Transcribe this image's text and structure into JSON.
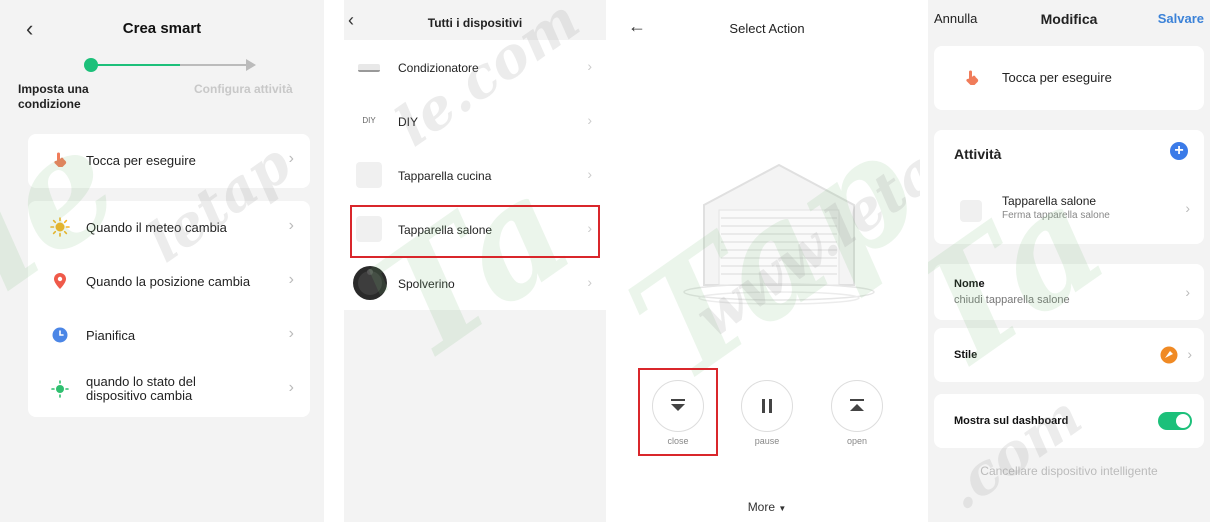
{
  "crea_smart": {
    "title": "Crea smart",
    "step1": "Imposta una condizione",
    "step2": "Configura attività",
    "tap_run": "Tocca per eseguire",
    "conditions": [
      {
        "label": "Quando il meteo cambia",
        "icon": "sun-icon"
      },
      {
        "label": "Quando la posizione cambia",
        "icon": "location-pin-icon"
      },
      {
        "label": "Pianifica",
        "icon": "clock-icon"
      },
      {
        "label": "quando lo stato del dispositivo cambia",
        "icon": "device-status-icon"
      }
    ]
  },
  "devices": {
    "title": "Tutti i dispositivi",
    "items": [
      {
        "name": "Condizionatore",
        "icon": "air-conditioner-icon"
      },
      {
        "name": "DIY",
        "icon": "diy-icon",
        "badge": "DIY"
      },
      {
        "name": "Tapparella cucina",
        "icon": "shutter-icon"
      },
      {
        "name": "Tapparella salone",
        "icon": "shutter-icon",
        "highlighted": true
      },
      {
        "name": "Spolverino",
        "icon": "robot-vacuum-icon"
      }
    ]
  },
  "action": {
    "title": "Select Action",
    "buttons": [
      {
        "label": "close",
        "icon": "close-shutter-icon",
        "highlighted": true
      },
      {
        "label": "pause",
        "icon": "pause-icon"
      },
      {
        "label": "open",
        "icon": "open-shutter-icon"
      }
    ],
    "more": "More"
  },
  "modifica": {
    "cancel": "Annulla",
    "title": "Modifica",
    "save": "Salvare",
    "tap_run": "Tocca per eseguire",
    "activities_title": "Attività",
    "activity_name": "Tapparella salone",
    "activity_sub": "Ferma tapparella salone",
    "name_label": "Nome",
    "name_value": "chiudi tapparella salone",
    "style_label": "Stile",
    "dashboard_label": "Mostra sul dashboard",
    "dashboard_on": true,
    "delete": "Cancellare dispositivo intelligente"
  },
  "colors": {
    "accent_green": "#1cc07a",
    "accent_blue": "#3b7be8",
    "highlight_red": "#d9262b",
    "style_orange": "#f08a24"
  }
}
